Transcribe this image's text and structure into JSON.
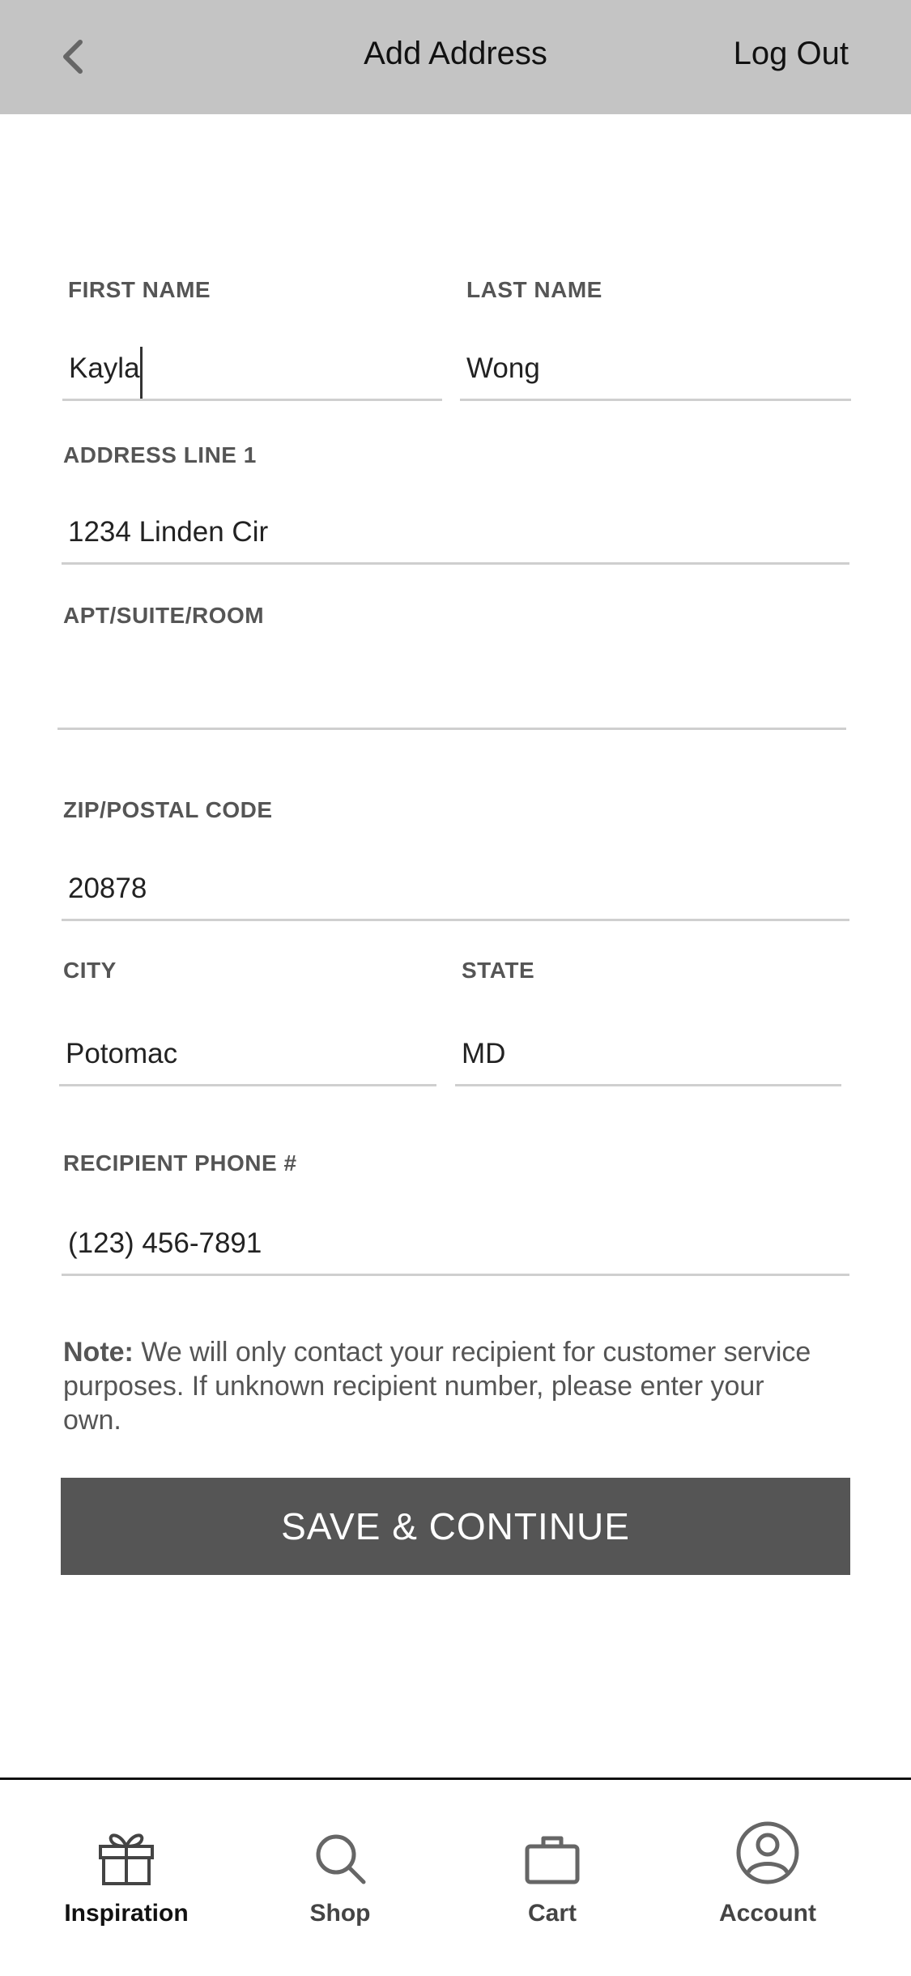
{
  "header": {
    "title": "Add Address",
    "logout_label": "Log Out"
  },
  "form": {
    "first_name": {
      "label": "FIRST NAME",
      "value": "Kayla"
    },
    "last_name": {
      "label": "LAST NAME",
      "value": "Wong"
    },
    "address_line1": {
      "label": "ADDRESS LINE 1",
      "value": "1234 Linden Cir"
    },
    "apt": {
      "label": "APT/SUITE/ROOM",
      "value": ""
    },
    "zip": {
      "label": "ZIP/POSTAL CODE",
      "value": "20878"
    },
    "city": {
      "label": "CITY",
      "value": "Potomac"
    },
    "state": {
      "label": "STATE",
      "value": "MD"
    },
    "phone": {
      "label": "RECIPIENT PHONE #",
      "value": "(123) 456-7891"
    }
  },
  "note": {
    "prefix": "Note:",
    "text": " We will only contact your recipient for customer service purposes. If unknown recipient number, please enter your own."
  },
  "save_button": {
    "label": "SAVE & CONTINUE"
  },
  "tabbar": {
    "items": [
      {
        "label": "Inspiration",
        "icon": "gift-icon",
        "active": true
      },
      {
        "label": "Shop",
        "icon": "search-icon",
        "active": false
      },
      {
        "label": "Cart",
        "icon": "briefcase-icon",
        "active": false
      },
      {
        "label": "Account",
        "icon": "user-circle-icon",
        "active": false
      }
    ]
  },
  "colors": {
    "header_bg": "#c4c4c4",
    "button_bg": "#555555",
    "field_line": "#cfcfcf"
  }
}
